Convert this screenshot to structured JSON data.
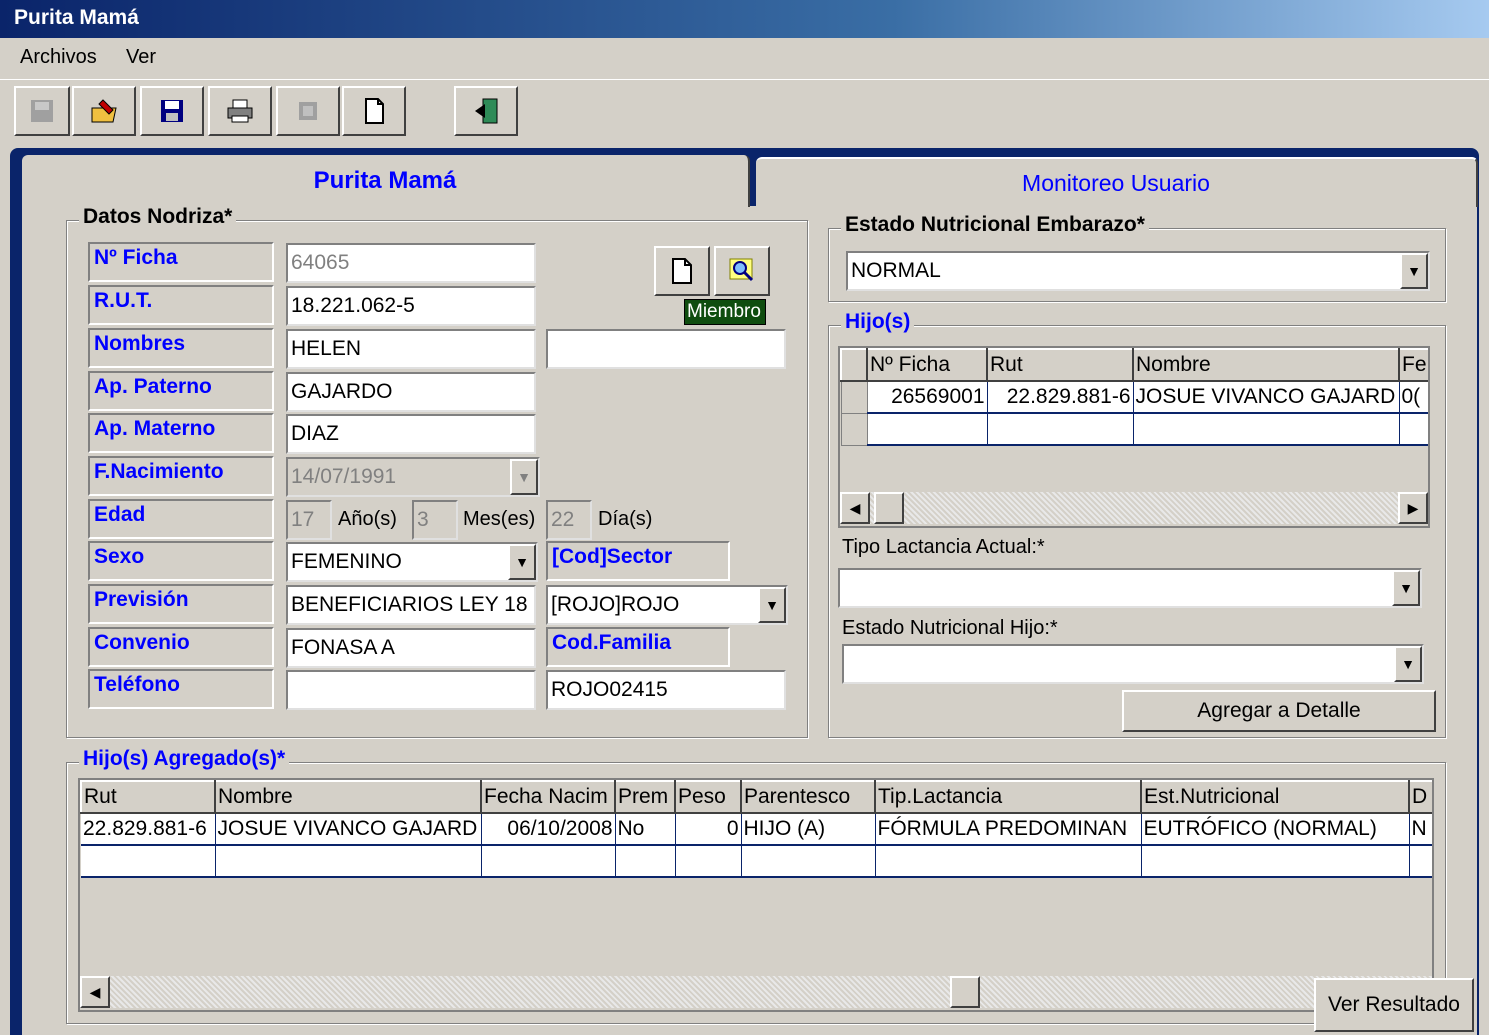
{
  "window": {
    "title": "Purita Mamá"
  },
  "menu": [
    "Archivos",
    "Ver"
  ],
  "toolbar": {
    "buttons": [
      "save-disabled-icon",
      "edit-folder-icon",
      "save-icon",
      "print-icon",
      "delete-disabled-icon",
      "new-document-icon",
      "exit-icon"
    ]
  },
  "tabs": {
    "active": "Purita Mamá",
    "inactive": "Monitoreo Usuario"
  },
  "datos": {
    "title": "Datos Nodriza*",
    "labels": {
      "ficha": "Nº Ficha",
      "rut": "R.U.T.",
      "nombres": "Nombres",
      "paterno": "Ap. Paterno",
      "materno": "Ap. Materno",
      "nacimiento": "F.Nacimiento",
      "edad": "Edad",
      "sexo": "Sexo",
      "prevision": "Previsión",
      "convenio": "Convenio",
      "telefono": "Teléfono",
      "sector": "[Cod]Sector",
      "familia": "Cod.Familia"
    },
    "values": {
      "ficha": "64065",
      "rut": "18.221.062-5",
      "nombres": "HELEN",
      "nombres2": "",
      "paterno": "GAJARDO",
      "materno": "DIAZ",
      "nacimiento": "14/07/1991",
      "edad_anos": "17",
      "edad_meses": "3",
      "edad_dias": "22",
      "sexo": "FEMENINO",
      "prevision": "BENEFICIARIOS LEY 18",
      "sector": "[ROJO]ROJO",
      "convenio": "FONASA A",
      "telefono": "",
      "familia": "ROJO02415"
    },
    "units": {
      "anos": "Año(s)",
      "meses": "Mes(es)",
      "dias": "Día(s)"
    },
    "miembro_tooltip": "Miembro"
  },
  "estado_embarazo": {
    "title": "Estado Nutricional Embarazo*",
    "value": "NORMAL"
  },
  "hijos": {
    "title": "Hijo(s)",
    "columns": [
      "Nº Ficha",
      "Rut",
      "Nombre",
      "Fe"
    ],
    "rows": [
      [
        "26569001",
        "22.829.881-6",
        "JOSUE VIVANCO GAJARD",
        "0("
      ],
      [
        "",
        "",
        "",
        ""
      ]
    ],
    "tipo_lactancia_label": "Tipo Lactancia Actual:*",
    "tipo_lactancia_value": "",
    "estado_hijo_label": "Estado Nutricional Hijo:*",
    "estado_hijo_value": "",
    "add_button": "Agregar a Detalle"
  },
  "agregados": {
    "title": "Hijo(s) Agregado(s)*",
    "columns": [
      "Rut",
      "Nombre",
      "Fecha Nacim",
      "Prem",
      "Peso",
      "Parentesco",
      "Tip.Lactancia",
      "Est.Nutricional",
      "D"
    ],
    "rows": [
      [
        "22.829.881-6",
        "JOSUE VIVANCO GAJARD",
        "06/10/2008",
        "No",
        "0",
        "HIJO (A)",
        "FÓRMULA PREDOMINAN",
        "EUTRÓFICO (NORMAL)",
        "N"
      ],
      [
        "",
        "",
        "",
        "",
        "",
        "",
        "",
        "",
        ""
      ]
    ]
  },
  "ver_resultado": "Ver Resultado"
}
